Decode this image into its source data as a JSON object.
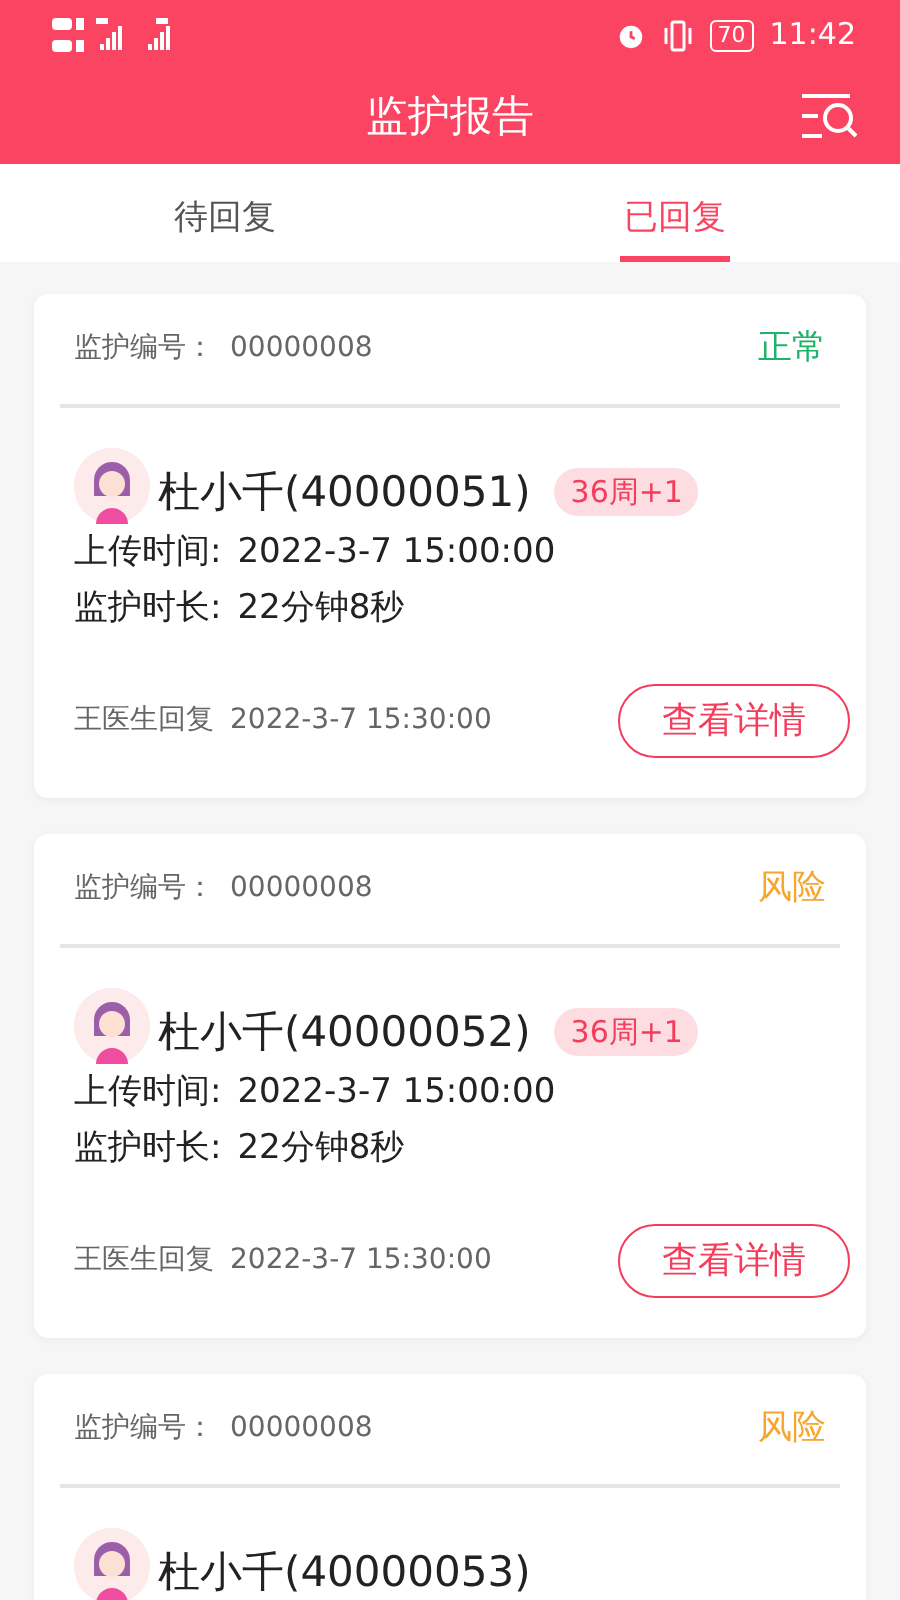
{
  "status_bar": {
    "time": "11:42",
    "battery": "70"
  },
  "header": {
    "title": "监护报告"
  },
  "tabs": [
    {
      "label": "待回复",
      "selected": false
    },
    {
      "label": "已回复",
      "selected": true
    }
  ],
  "reports": [
    {
      "number_label": "监护编号：",
      "number": "00000008",
      "status": "正常",
      "color": "#1cb36a",
      "name": "杜小千(40000051)",
      "tag": "36周+1",
      "upload_label": "上传时间:",
      "upload_time": "2022-3-7  15:00:00",
      "duration_label": "监护时长:",
      "duration": "22分钟8秒",
      "reply": "王医生回复",
      "reply_time": "2022-3-7  15:30:00",
      "button": "查看详情"
    },
    {
      "number_label": "监护编号：",
      "number": "00000008",
      "status": "风险",
      "color": "#f7a52b",
      "name": "杜小千(40000052)",
      "tag": "36周+1",
      "upload_label": "上传时间:",
      "upload_time": "2022-3-7  15:00:00",
      "duration_label": "监护时长:",
      "duration": "22分钟8秒",
      "reply": "王医生回复",
      "reply_time": "2022-3-7  15:30:00",
      "button": "查看详情"
    },
    {
      "number_label": "监护编号：",
      "number": "00000008",
      "status": "风险",
      "color": "#f7a52b",
      "name": "杜小千(40000053)"
    }
  ]
}
